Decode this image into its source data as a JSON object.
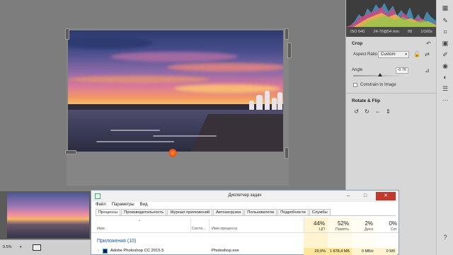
{
  "camera_info": {
    "iso": "ISO 640",
    "lens": "24-70@54 mm",
    "aperture": "f/8",
    "shutter": "1/160s"
  },
  "crop": {
    "title": "Crop",
    "aspect_ratio_label": "Aspect Ratio",
    "aspect_ratio_value": "Custom",
    "angle_label": "Angle",
    "angle_value": "-0.76",
    "constrain_label": "Constrain to Image"
  },
  "rotate": {
    "title": "Rotate & Flip"
  },
  "statusbar": {
    "zoom": "9.5%"
  },
  "task_manager": {
    "title": "Диспетчер задач",
    "menu": [
      "Файл",
      "Параметры",
      "Вид"
    ],
    "tabs": [
      "Процессы",
      "Производительность",
      "Журнал приложений",
      "Автозагрузка",
      "Пользователи",
      "Подробности",
      "Службы"
    ],
    "columns": {
      "name": "Имя",
      "status": "Состо...",
      "process_name": "Имя процесса",
      "cpu": {
        "pct": "44%",
        "label": "ЦП"
      },
      "memory": {
        "pct": "52%",
        "label": "Память"
      },
      "disk": {
        "pct": "2%",
        "label": "Диск"
      },
      "network": {
        "pct": "0%",
        "label": "Сет"
      }
    },
    "group": "Приложения (10)",
    "processes": [
      {
        "name": "Adobe Photoshop CC 2015.5",
        "file": "Photoshop.exe",
        "cpu": "29,0%",
        "memory": "1 878,4 МБ",
        "disk": "0 МБ/с",
        "network": "0 Мб"
      }
    ]
  },
  "colors": {
    "accent_orange": "#e1571b",
    "panel_bg": "#d7d7d7",
    "tm_highlight": "#fde59a"
  }
}
